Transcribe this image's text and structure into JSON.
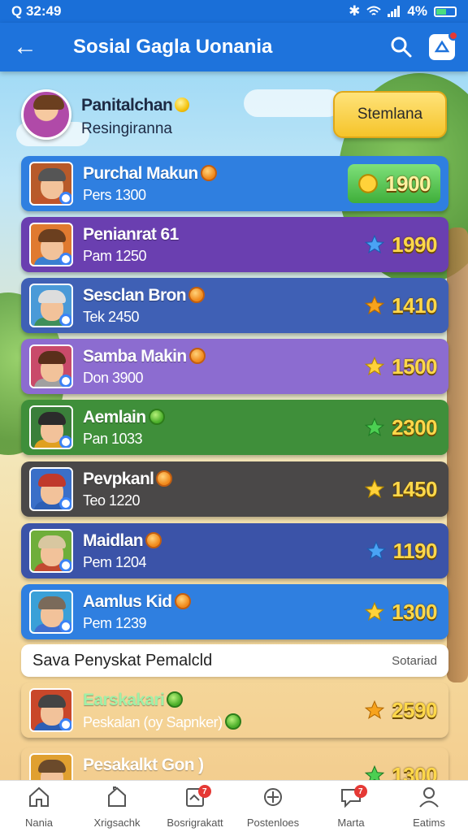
{
  "status_bar": {
    "time": "Q 32:49",
    "battery": "4%"
  },
  "app_bar": {
    "title": "Sosial Gagla Uonania"
  },
  "me": {
    "name": "Panitalchan",
    "subtitle": "Resingiranna",
    "cta_label": "Stemlana"
  },
  "leaderboard": [
    {
      "name": "Purchal Makun",
      "score": "Pers 1300",
      "points": "1900",
      "color": "#2f7fe0",
      "points_style": "box",
      "icon": "coin-icon",
      "medal": "orange"
    },
    {
      "name": "Penianrat 61",
      "score": "Pam 1250",
      "points": "1990",
      "color": "#6a3fb0",
      "icon": "star-icon-blue",
      "medal": "none"
    },
    {
      "name": "Sesclan Bron",
      "score": "Tek 2450",
      "points": "1410",
      "color": "#3f60b5",
      "icon": "star-icon-orange",
      "medal": "orange"
    },
    {
      "name": "Samba Makin",
      "score": "Don 3900",
      "points": "1500",
      "color": "#8c6cd0",
      "icon": "star-icon-gold",
      "medal": "orange"
    },
    {
      "name": "Aemlain",
      "score": "Pan 1033",
      "points": "2300",
      "color": "#3f8f3a",
      "icon": "star-icon-green",
      "medal": "green"
    },
    {
      "name": "Pevpkanl",
      "score": "Teo 1220",
      "points": "1450",
      "color": "#4a4848",
      "icon": "star-icon-gold",
      "medal": "orange"
    },
    {
      "name": "Maidlan",
      "score": "Pem 1204",
      "points": "1190",
      "color": "#3b53a8",
      "icon": "star-icon-blue",
      "medal": "orange"
    },
    {
      "name": "Aamlus Kid",
      "score": "Pem 1239",
      "points": "1300",
      "color": "#2f7fe0",
      "icon": "star-icon-gold",
      "medal": "orange"
    }
  ],
  "divider": {
    "left": "Sava Penyskat Pemalcld",
    "right": "Sotariad"
  },
  "my_rank": {
    "name": "Earskakari",
    "score": "Peskalan (oy Sapnker)",
    "points": "2590",
    "color": "#3a3f4a",
    "icon": "star-icon-orange"
  },
  "partial_row": {
    "name": "Pesakalkt Gon )",
    "points": "1300",
    "color": "#3b53a8"
  },
  "bottom_nav": [
    {
      "label": "Nania",
      "icon": "home-icon"
    },
    {
      "label": "Xrigsachk",
      "icon": "house-outline-icon"
    },
    {
      "label": "Bosrigrakatt",
      "icon": "clipboard-icon",
      "badge": "7"
    },
    {
      "label": "Postenloes",
      "icon": "crosshair-icon"
    },
    {
      "label": "Marta",
      "icon": "chat-icon",
      "badge": "7"
    },
    {
      "label": "Eatims",
      "icon": "person-icon"
    }
  ]
}
